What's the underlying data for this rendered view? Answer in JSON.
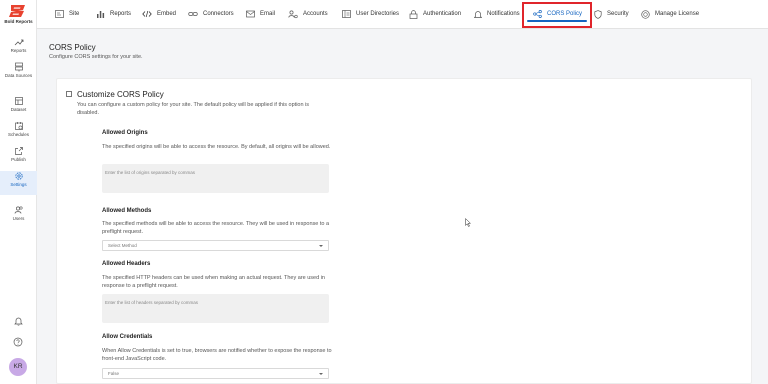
{
  "app": {
    "logo_text": "Bold Reports"
  },
  "sidebar": {
    "items": [
      {
        "label": "Reports",
        "icon": "trend-icon"
      },
      {
        "label": "Data Sources",
        "icon": "datasource-icon"
      },
      {
        "label": "Dataset",
        "icon": "dataset-icon"
      },
      {
        "label": "Schedules",
        "icon": "schedule-icon"
      },
      {
        "label": "Publish",
        "icon": "publish-icon"
      },
      {
        "label": "Settings",
        "icon": "gear-icon",
        "active": true
      },
      {
        "label": "Users",
        "icon": "users-icon"
      }
    ],
    "bottom_icons": [
      "bell-icon",
      "help-icon"
    ],
    "avatar_initials": "KR"
  },
  "topnav": {
    "tabs": [
      {
        "label": "Site",
        "icon": "site-icon"
      },
      {
        "label": "Reports",
        "icon": "bar-chart-icon"
      },
      {
        "label": "Embed",
        "icon": "code-icon"
      },
      {
        "label": "Connectors",
        "icon": "link-icon"
      },
      {
        "label": "Email",
        "icon": "email-icon"
      },
      {
        "label": "Accounts",
        "icon": "accounts-icon"
      },
      {
        "label": "User Directories",
        "icon": "directory-icon"
      },
      {
        "label": "Authentication",
        "icon": "lock-icon"
      },
      {
        "label": "Notifications",
        "icon": "bell-icon"
      },
      {
        "label": "CORS Policy",
        "icon": "cors-icon",
        "active": true
      },
      {
        "label": "Security",
        "icon": "shield-icon"
      },
      {
        "label": "Manage License",
        "icon": "license-icon"
      }
    ],
    "active_color": "#1565c0",
    "highlight_color": "#e0252b"
  },
  "page": {
    "title": "CORS Policy",
    "subtitle": "Configure CORS settings for your site."
  },
  "form": {
    "customize": {
      "label": "Customize CORS Policy",
      "checked": false,
      "description": "You can configure a custom policy for your site. The default policy will be applied if this option is disabled."
    },
    "allowed_origins": {
      "title": "Allowed Origins",
      "description": "The specified origins will be able to access the resource. By default, all origins will be allowed.",
      "placeholder": "Enter the list of origins separated by commas"
    },
    "allowed_methods": {
      "title": "Allowed Methods",
      "description": "The specified methods will be able to access the resource. They will be used in response to a preflight request.",
      "selected": "Select Method"
    },
    "allowed_headers": {
      "title": "Allowed Headers",
      "description": "The specified HTTP headers can be used when making an actual request. They are used in response to a preflight request.",
      "placeholder": "Enter the list of headers separated by commas"
    },
    "allow_credentials": {
      "title": "Allow Credentials",
      "description": "When Allow Credentials is set to true, browsers are notified whether to expose the response to front-end JavaScript code.",
      "selected": "False"
    }
  }
}
